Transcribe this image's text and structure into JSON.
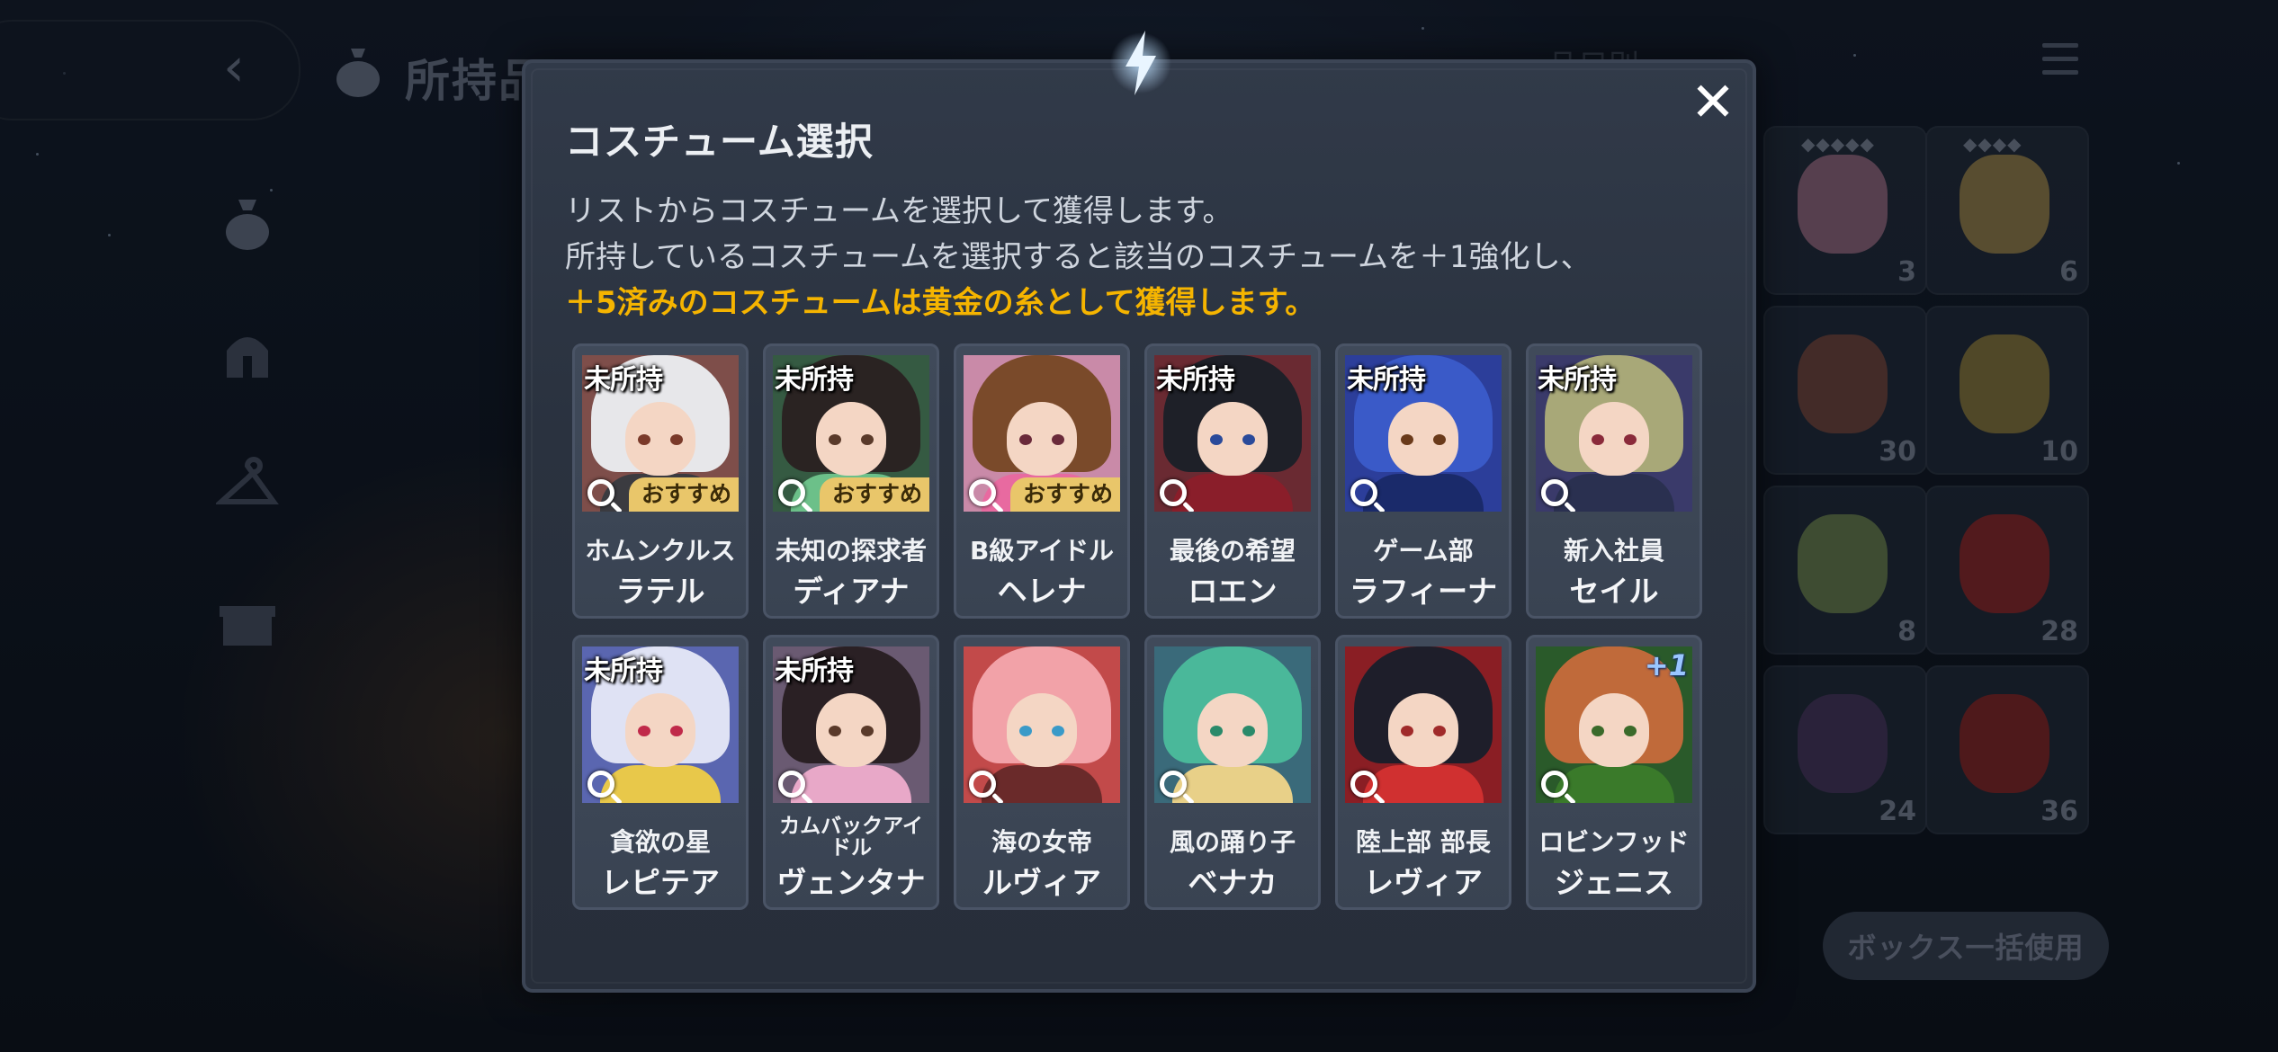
{
  "header": {
    "title": "所持品",
    "filter_label": "品目別"
  },
  "inventory": {
    "items": [
      {
        "qty": "3",
        "gems": "◆◆◆◆◆",
        "color": "#d68aa4"
      },
      {
        "qty": "6",
        "gems": "◆◆◆◆",
        "color": "#d8b050"
      },
      {
        "qty": "30",
        "color": "#a0523a"
      },
      {
        "qty": "10",
        "color": "#c2a23a"
      },
      {
        "qty": "8",
        "color": "#8fae58"
      },
      {
        "qty": "28",
        "color": "#c8231e"
      },
      {
        "qty": "24",
        "color": "#5a3a6e"
      },
      {
        "qty": "36",
        "color": "#c02018"
      }
    ],
    "bulk_button": "ボックス一括使用"
  },
  "modal": {
    "title": "コスチューム選択",
    "desc_line1": "リストからコスチュームを選択して獲得します。",
    "desc_line2": "所持しているコスチュームを選択すると該当のコスチュームを＋1強化し、",
    "desc_highlight": "＋5済みのコスチュームは黄金の糸として獲得します。",
    "unowned_label": "未所持",
    "recommended_label": "おすすめ",
    "colors": {
      "highlight": "#f5b400",
      "recommended_badge": "#e9c66a"
    },
    "costumes": [
      {
        "title": "ホムンクルス",
        "name": "ラテル",
        "unowned": true,
        "recommended": true,
        "plus": "",
        "bg": "#7e4e4a",
        "hair": "#e7e7ea",
        "body": "#3b3b40",
        "eye": "#7a3a2a"
      },
      {
        "title": "未知の探求者",
        "name": "ディアナ",
        "unowned": true,
        "recommended": true,
        "plus": "",
        "bg": "#355a42",
        "hair": "#2a2322",
        "body": "#6cc089",
        "eye": "#5a3a2a"
      },
      {
        "title": "B級アイドル",
        "name": "ヘレナ",
        "unowned": false,
        "recommended": true,
        "plus": "",
        "bg": "#c98aa8",
        "hair": "#7a4a2a",
        "body": "#e86aa0",
        "eye": "#6a2a3a"
      },
      {
        "title": "最後の希望",
        "name": "ロエン",
        "unowned": true,
        "recommended": false,
        "plus": "",
        "bg": "#6a2a32",
        "hair": "#1e2028",
        "body": "#8a1e2a",
        "eye": "#2a4a9a"
      },
      {
        "title": "ゲーム部",
        "name": "ラフィーナ",
        "unowned": true,
        "recommended": false,
        "plus": "",
        "bg": "#2c3e9a",
        "hair": "#3a5ac8",
        "body": "#1a2a6a",
        "eye": "#6a3a1a"
      },
      {
        "title": "新入社員",
        "name": "セイル",
        "unowned": true,
        "recommended": false,
        "plus": "",
        "bg": "#3a3a6a",
        "hair": "#a8a878",
        "body": "#2a3050",
        "eye": "#8a2a3a"
      },
      {
        "title": "貪欲の星",
        "name": "レピテア",
        "unowned": true,
        "recommended": false,
        "plus": "",
        "bg": "#5a66b0",
        "hair": "#dfe2f4",
        "body": "#e8c84a",
        "eye": "#c02a4a"
      },
      {
        "title": "カムバックアイドル",
        "name": "ヴェンタナ",
        "unowned": true,
        "recommended": false,
        "plus": "",
        "bg": "#6a5a72",
        "hair": "#2a2024",
        "body": "#e8a8c8",
        "eye": "#5a3a2a"
      },
      {
        "title": "海の女帝",
        "name": "ルヴィア",
        "unowned": false,
        "recommended": false,
        "plus": "",
        "bg": "#c24a4a",
        "hair": "#f2a2a8",
        "body": "#6a2a2a",
        "eye": "#3a9ac8"
      },
      {
        "title": "風の踊り子",
        "name": "ベナカ",
        "unowned": false,
        "recommended": false,
        "plus": "",
        "bg": "#3a6a7a",
        "hair": "#4ab89a",
        "body": "#e8d088",
        "eye": "#2a8a6a"
      },
      {
        "title": "陸上部 部長",
        "name": "レヴィア",
        "unowned": false,
        "recommended": false,
        "plus": "",
        "bg": "#8a1e24",
        "hair": "#1e1e2a",
        "body": "#d03030",
        "eye": "#a02a2a"
      },
      {
        "title": "ロビンフッド",
        "name": "ジェニス",
        "unowned": false,
        "recommended": false,
        "plus": "+1",
        "bg": "#2a5a2a",
        "hair": "#c06a3a",
        "body": "#3a7a2a",
        "eye": "#3a6a2a"
      }
    ]
  }
}
